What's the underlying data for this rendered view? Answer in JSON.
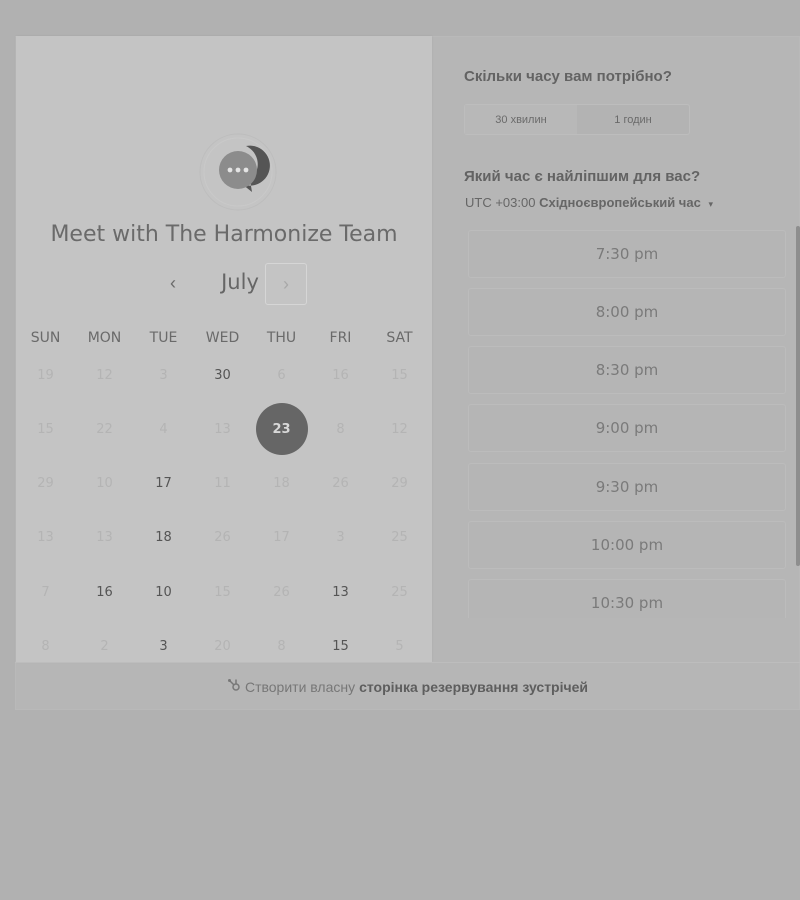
{
  "calendar": {
    "title": "Meet with The Harmonize Team",
    "month": "July",
    "prev_icon": "‹",
    "next_icon": "›",
    "weekdays": [
      "SUN",
      "MON",
      "TUE",
      "WED",
      "THU",
      "FRI",
      "SAT"
    ],
    "weeks": [
      [
        "19",
        "12",
        "3",
        "30",
        "6",
        "16",
        "15"
      ],
      [
        "15",
        "22",
        "4",
        "13",
        "23",
        "8",
        "12"
      ],
      [
        "29",
        "10",
        "17",
        "11",
        "18",
        "26",
        "29"
      ],
      [
        "13",
        "13",
        "18",
        "26",
        "17",
        "3",
        "25"
      ],
      [
        "7",
        "16",
        "10",
        "15",
        "26",
        "13",
        "25"
      ],
      [
        "8",
        "2",
        "3",
        "20",
        "8",
        "15",
        "5"
      ]
    ],
    "available": [
      [
        0,
        3
      ],
      [
        1,
        4
      ],
      [
        2,
        2
      ],
      [
        3,
        2
      ],
      [
        4,
        1
      ],
      [
        4,
        2
      ],
      [
        4,
        5
      ],
      [
        5,
        2
      ],
      [
        5,
        5
      ]
    ],
    "selected": [
      1,
      4
    ]
  },
  "booking": {
    "duration_question": "Скільки часу вам потрібно?",
    "durations": [
      "30 хвилин",
      "1 годин"
    ],
    "active_duration": "30 хвилин",
    "time_question": "Який час є найліпшим для вас?",
    "timezone_offset": "UTC +03:00",
    "timezone_name": "Східноєвропейський час",
    "timezone_caret": "▾",
    "slots": [
      "7:30 pm",
      "8:00 pm",
      "8:30 pm",
      "9:00 pm",
      "9:30 pm",
      "10:00 pm",
      "10:30 pm"
    ]
  },
  "footer": {
    "icon": "sprocket-icon",
    "text": "Створити власну",
    "link": "сторінка резервування зустрічей"
  },
  "colors": {
    "selected_day": "#666666",
    "background": "#b1b1b1"
  }
}
